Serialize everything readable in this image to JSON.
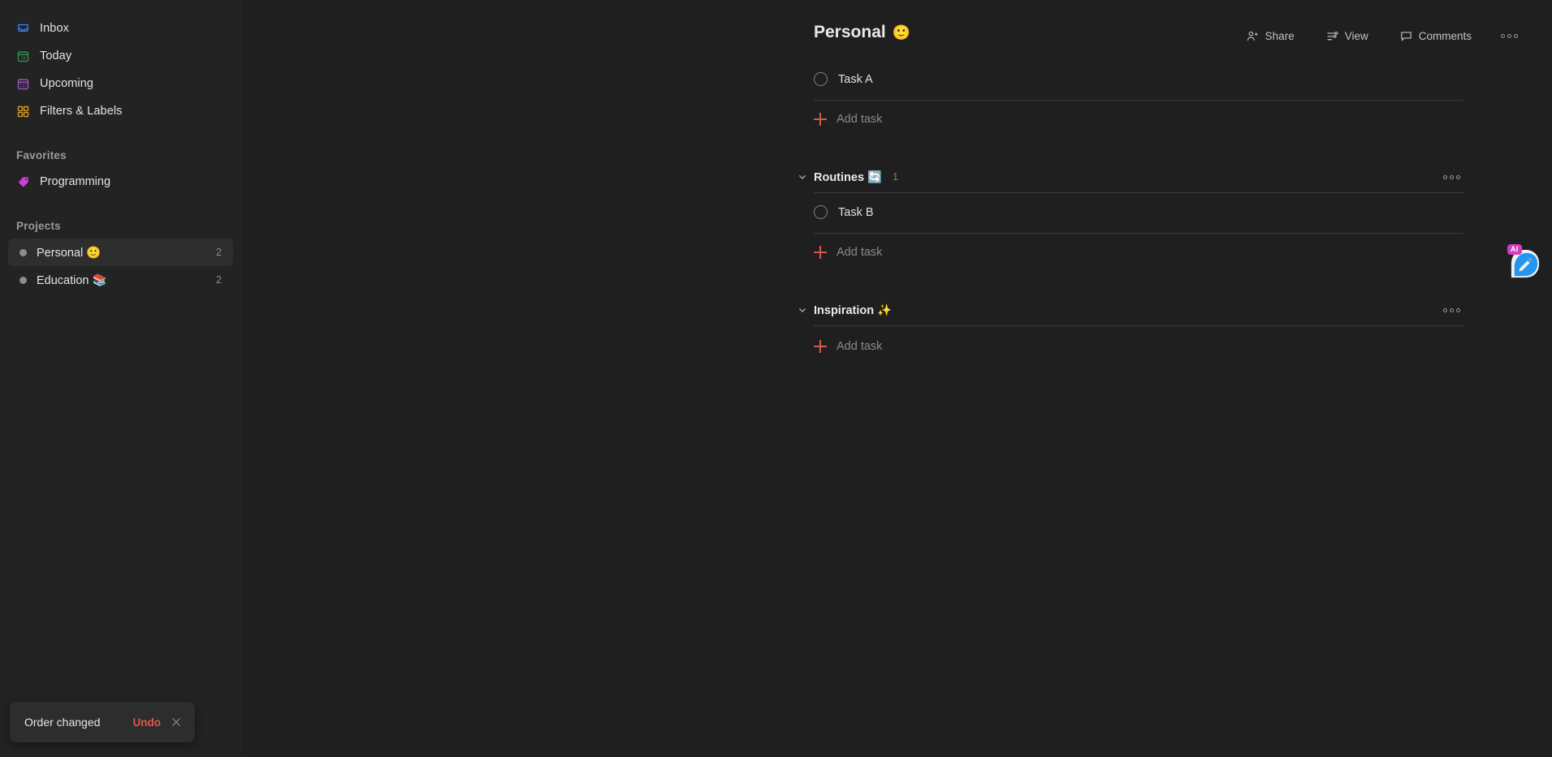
{
  "sidebar": {
    "nav": [
      {
        "label": "Inbox",
        "icon": "inbox-icon",
        "color": "#3b82f6"
      },
      {
        "label": "Today",
        "icon": "calendar-today-icon",
        "color": "#2f9e52"
      },
      {
        "label": "Upcoming",
        "icon": "calendar-grid-icon",
        "color": "#9d5bd2"
      },
      {
        "label": "Filters & Labels",
        "icon": "grid-squares-icon",
        "color": "#d99a2b"
      }
    ],
    "favorites_heading": "Favorites",
    "favorites": [
      {
        "label": "Programming",
        "icon": "tag-icon",
        "color": "#cf3ed4"
      }
    ],
    "projects_heading": "Projects",
    "projects": [
      {
        "label": "Personal 🙂",
        "count": "2",
        "active": true
      },
      {
        "label": "Education 📚",
        "count": "2",
        "active": false
      }
    ]
  },
  "header": {
    "title": "Personal",
    "title_emoji": "🙂",
    "actions": [
      {
        "label": "Share",
        "icon": "share-person-plus-icon"
      },
      {
        "label": "View",
        "icon": "sliders-view-icon"
      },
      {
        "label": "Comments",
        "icon": "comment-bubble-icon"
      }
    ],
    "more_label": "more-options"
  },
  "main": {
    "root_section": {
      "tasks": [
        {
          "text": "Task A"
        }
      ],
      "add_task_label": "Add task"
    },
    "sections": [
      {
        "title": "Routines 🔄",
        "count": "1",
        "collapsed": false,
        "tasks": [
          {
            "text": "Task B"
          }
        ],
        "add_task_label": "Add task"
      },
      {
        "title": "Inspiration ✨",
        "count": "",
        "collapsed": false,
        "tasks": [],
        "add_task_label": "Add task"
      }
    ]
  },
  "ai_button": {
    "badge": "AI",
    "name": "ai-assistant-button"
  },
  "toast": {
    "message": "Order changed",
    "undo_label": "Undo",
    "close_label": "close",
    "undo_color": "#e0584a"
  }
}
